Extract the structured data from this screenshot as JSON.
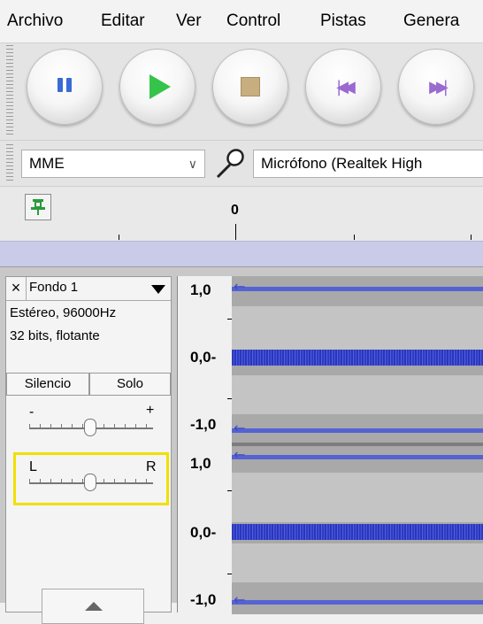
{
  "menu": {
    "items": [
      "Archivo",
      "Editar",
      "Ver",
      "Control",
      "Pistas",
      "Genera"
    ]
  },
  "transport": {
    "buttons": [
      "pause",
      "play",
      "stop",
      "skip-to-start",
      "skip-to-end"
    ]
  },
  "device": {
    "host": "MME",
    "recording_device": "Micrófono (Realtek High"
  },
  "ruler": {
    "zero_label": "0"
  },
  "track": {
    "close_label": "×",
    "name": "Fondo 1",
    "format_line1": "Estéreo, 96000Hz",
    "format_line2": "32 bits, flotante",
    "mute_label": "Silencio",
    "solo_label": "Solo",
    "gain_minus": "-",
    "gain_plus": "+",
    "pan_left": "L",
    "pan_right": "R"
  },
  "scale": {
    "ch1_top": "1,0",
    "ch1_mid": "0,0-",
    "ch1_bottom": "-1,0",
    "ch2_top": "1,0",
    "ch2_mid": "0,0-",
    "ch2_bottom": "-1,0"
  },
  "colors": {
    "pan_highlight": "#f0e000",
    "waveform": "#3a46c8"
  }
}
